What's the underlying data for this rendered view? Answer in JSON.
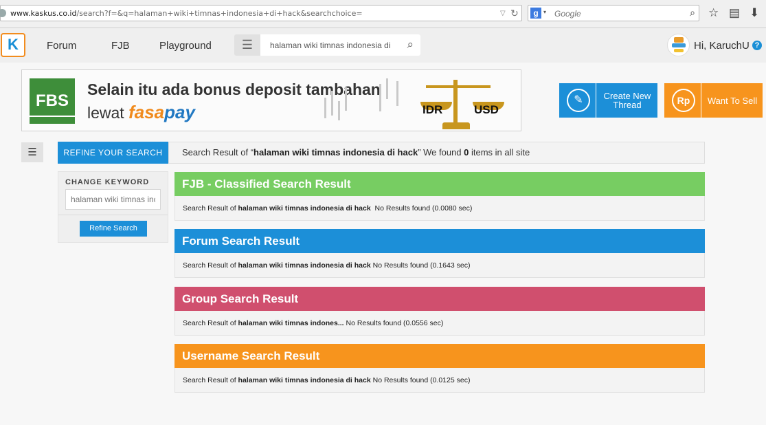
{
  "browser": {
    "url_domain": "www.kaskus.co.id",
    "url_path": "/search?f=&q=halaman+wiki+timnas+indonesia+di+hack&searchchoice=",
    "search_engine_placeholder": "Google"
  },
  "header": {
    "logo_text": "K",
    "nav": [
      "Forum",
      "FJB",
      "Playground"
    ],
    "search_value": "halaman wiki timnas indonesia di hack",
    "greeting": "Hi, KaruchU",
    "help_symbol": "?"
  },
  "banner": {
    "brand": "FBS",
    "line1": "Selain itu ada bonus deposit tambahan",
    "line2_prefix": "lewat",
    "fasapay_a": "fasa",
    "fasapay_b": "pay",
    "currency_left": "IDR",
    "currency_right": "USD"
  },
  "actions": {
    "create_thread": "Create New Thread",
    "want_to_sell": "Want To Sell",
    "rp_symbol": "Rp"
  },
  "sidebar": {
    "refine_tab": "REFINE YOUR SEARCH",
    "change_keyword_label": "CHANGE KEYWORD",
    "keyword_value": "halaman wiki timnas indonesia di hack",
    "refine_button": "Refine Search"
  },
  "summary": {
    "prefix": "Search Result of “",
    "query": "halaman wiki timnas indonesia di hack",
    "middle": "” We found ",
    "count": "0",
    "suffix": " items in all site"
  },
  "results": [
    {
      "title": "FJB - Classified Search Result",
      "prefix": "Search Result of ",
      "query": "halaman wiki timnas indonesia di hack",
      "status": "  No Results found (0.0080 sec)",
      "color": "#77cd62"
    },
    {
      "title": "Forum Search Result",
      "prefix": "Search Result of ",
      "query": "halaman wiki timnas indonesia di hack",
      "status": " No Results found (0.1643 sec)",
      "color": "#1c8fd8"
    },
    {
      "title": "Group Search Result",
      "prefix": "Search Result of ",
      "query": "halaman wiki timnas indones...",
      "status": " No Results found (0.0556 sec)",
      "color": "#d04f6e"
    },
    {
      "title": "Username Search Result",
      "prefix": "Search Result of ",
      "query": "halaman wiki timnas indonesia di hack",
      "status": " No Results found (0.0125 sec)",
      "color": "#f7941d"
    }
  ]
}
